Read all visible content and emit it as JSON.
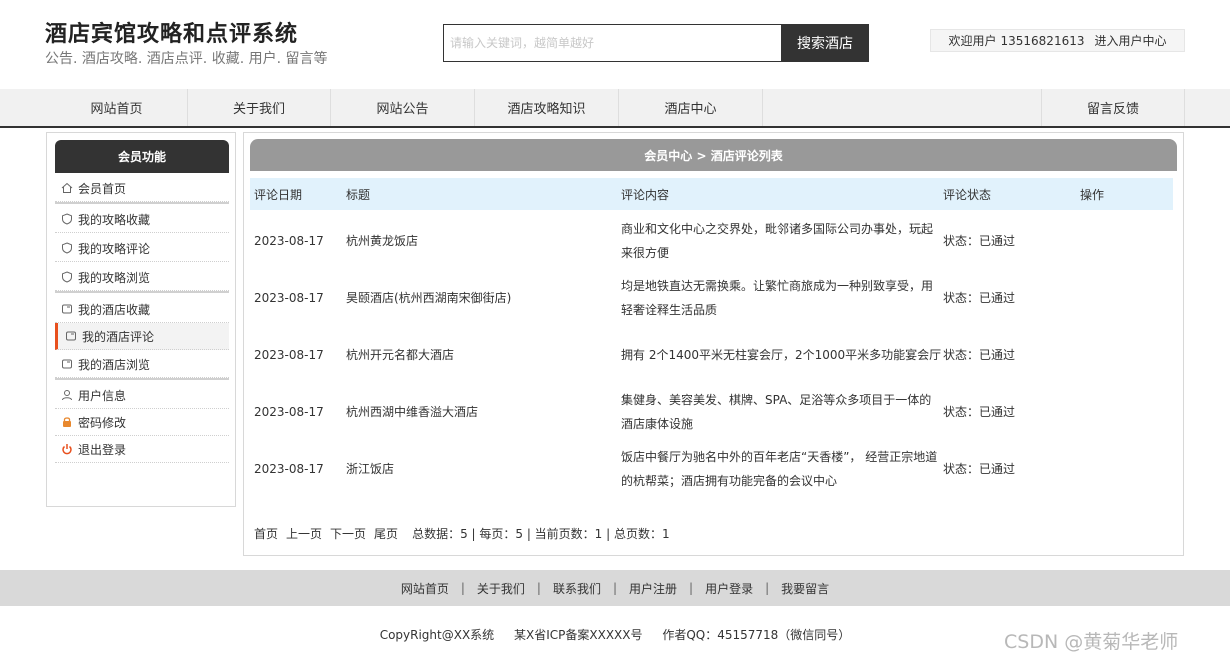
{
  "header": {
    "title": "酒店宾馆攻略和点评系统",
    "subtitle": "公告. 酒店攻略. 酒店点评. 收藏. 用户. 留言等",
    "search_placeholder": "请输入关键词，越简单越好",
    "search_button": "搜索酒店",
    "welcome_text": "欢迎用户",
    "username": "13516821613",
    "user_center_link": "进入用户中心"
  },
  "nav": {
    "items": [
      {
        "label": "网站首页"
      },
      {
        "label": "关于我们"
      },
      {
        "label": "网站公告"
      },
      {
        "label": "酒店攻略知识"
      },
      {
        "label": "酒店中心"
      },
      {
        "label": "留言反馈"
      }
    ]
  },
  "sidebar": {
    "title": "会员功能",
    "items": [
      {
        "label": "会员首页",
        "icon": "home-icon"
      },
      {
        "label": "我的攻略收藏",
        "icon": "shield-icon"
      },
      {
        "label": "我的攻略评论",
        "icon": "shield-icon"
      },
      {
        "label": "我的攻略浏览",
        "icon": "shield-icon"
      },
      {
        "label": "我的酒店收藏",
        "icon": "hotel-icon"
      },
      {
        "label": "我的酒店评论",
        "icon": "hotel-icon",
        "active": true
      },
      {
        "label": "我的酒店浏览",
        "icon": "hotel-icon"
      },
      {
        "label": "用户信息",
        "icon": "user-icon"
      },
      {
        "label": "密码修改",
        "icon": "lock-icon"
      },
      {
        "label": "退出登录",
        "icon": "power-icon"
      }
    ]
  },
  "main": {
    "breadcrumb": "会员中心 > 酒店评论列表",
    "columns": [
      "评论日期",
      "标题",
      "评论内容",
      "评论状态",
      "操作"
    ],
    "rows": [
      {
        "date": "2023-08-17",
        "title": "杭州黄龙饭店",
        "content": "商业和文化中心之交界处，毗邻诸多国际公司办事处，玩起来很方便",
        "status": "状态：已通过"
      },
      {
        "date": "2023-08-17",
        "title": "昊颐酒店(杭州西湖南宋御街店)",
        "content": "均是地铁直达无需换乘。让繁忙商旅成为一种别致享受，用轻奢诠释生活品质",
        "status": "状态：已通过"
      },
      {
        "date": "2023-08-17",
        "title": "杭州开元名都大酒店",
        "content": "拥有 2个1400平米无柱宴会厅，2个1000平米多功能宴会厅",
        "status": "状态：已通过"
      },
      {
        "date": "2023-08-17",
        "title": "杭州西湖中维香溢大酒店",
        "content": "集健身、美容美发、棋牌、SPA、足浴等众多项目于一体的酒店康体设施",
        "status": "状态：已通过"
      },
      {
        "date": "2023-08-17",
        "title": "浙江饭店",
        "content": "饭店中餐厅为驰名中外的百年老店“天香楼”， 经营正宗地道的杭帮菜；酒店拥有功能完备的会议中心",
        "status": "状态：已通过"
      }
    ],
    "pager": {
      "first": "首页",
      "prev": "上一页",
      "next": "下一页",
      "last": "尾页",
      "summary": "总数据：5 | 每页：5 | 当前页数：1 | 总页数：1"
    }
  },
  "footer": {
    "links": [
      "网站首页",
      "关于我们",
      "联系我们",
      "用户注册",
      "用户登录",
      "我要留言"
    ],
    "copyright": "CopyRight@XX系统",
    "icp": "某X省ICP备案XXXXX号",
    "contact": "作者QQ：45157718（微信同号）",
    "watermark": "CSDN @黄菊华老师"
  }
}
